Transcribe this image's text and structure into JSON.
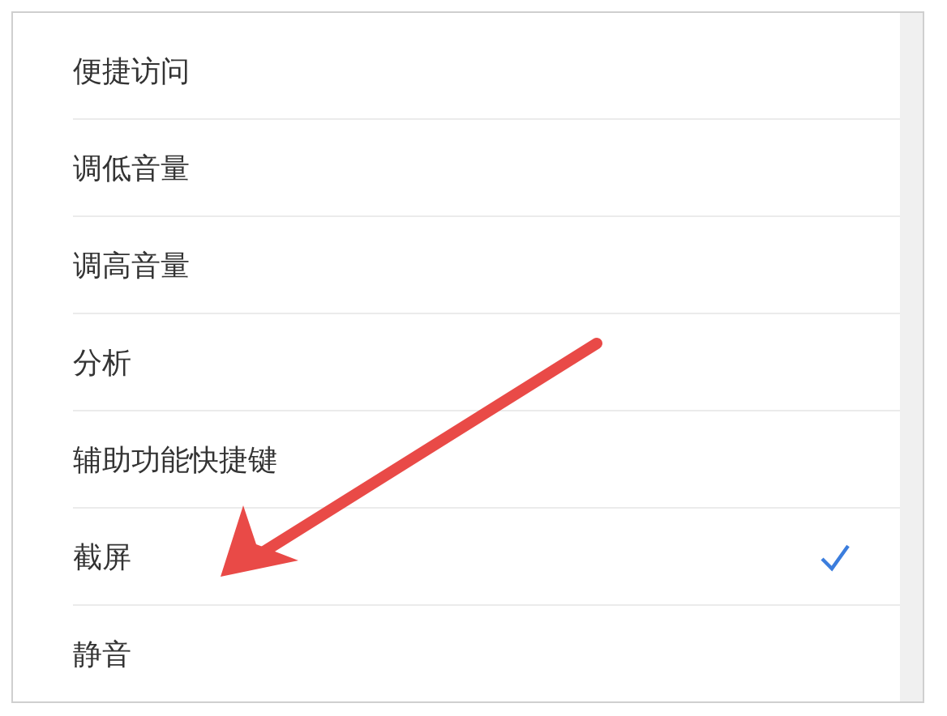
{
  "options": [
    {
      "label": "便捷访问",
      "selected": false
    },
    {
      "label": "调低音量",
      "selected": false
    },
    {
      "label": "调高音量",
      "selected": false
    },
    {
      "label": "分析",
      "selected": false
    },
    {
      "label": "辅助功能快捷键",
      "selected": false
    },
    {
      "label": "截屏",
      "selected": true
    },
    {
      "label": "静音",
      "selected": false
    }
  ]
}
